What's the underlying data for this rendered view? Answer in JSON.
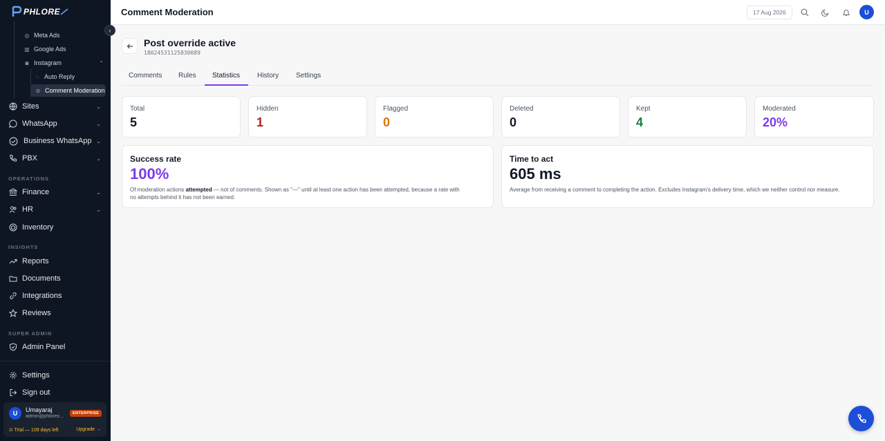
{
  "brand": {
    "name": "PHLORE"
  },
  "sidebar": {
    "sub_items": [
      {
        "label": "Meta Ads",
        "icon": "meta-icon"
      },
      {
        "label": "Google Ads",
        "icon": "building-icon"
      },
      {
        "label": "Instagram",
        "icon": "instagram-icon"
      },
      {
        "label": "Auto Reply",
        "icon": "auto-reply-icon"
      },
      {
        "label": "Comment Moderation",
        "icon": "moderation-icon"
      }
    ],
    "items": [
      {
        "label": "Sites",
        "icon": "globe-icon"
      },
      {
        "label": "WhatsApp",
        "icon": "chat-icon"
      },
      {
        "label": "Business WhatsApp",
        "icon": "check-circle-icon"
      },
      {
        "label": "PBX",
        "icon": "phone-icon"
      },
      {
        "label": "Finance",
        "icon": "bank-icon"
      },
      {
        "label": "HR",
        "icon": "people-icon"
      },
      {
        "label": "Inventory",
        "icon": "box-icon"
      },
      {
        "label": "Reports",
        "icon": "chart-icon"
      },
      {
        "label": "Documents",
        "icon": "folder-icon"
      },
      {
        "label": "Integrations",
        "icon": "link-icon"
      },
      {
        "label": "Reviews",
        "icon": "star-icon"
      },
      {
        "label": "Admin Panel",
        "icon": "shield-icon"
      },
      {
        "label": "Settings",
        "icon": "gear-icon"
      },
      {
        "label": "Sign out",
        "icon": "logout-icon"
      }
    ],
    "sections": {
      "operations": "OPERATIONS",
      "insights": "INSIGHTS",
      "super_admin": "SUPER ADMIN"
    },
    "user": {
      "initial": "U",
      "name": "Umayaraj",
      "email": "admin@phlorex...",
      "plan": "ENTERPRISE",
      "trial": "⊙ Trial — 109 days left",
      "upgrade": "Upgrade →"
    }
  },
  "topbar": {
    "title": "Comment Moderation",
    "date": "17 Aug 2026",
    "avatar": "U"
  },
  "post": {
    "title": "Post override active",
    "id": "18024531125830089"
  },
  "tabs": [
    "Comments",
    "Rules",
    "Statistics",
    "History",
    "Settings"
  ],
  "active_tab": "Statistics",
  "stats": [
    {
      "label": "Total",
      "value": "5",
      "color": "#111827"
    },
    {
      "label": "Hidden",
      "value": "1",
      "color": "#b91c1c"
    },
    {
      "label": "Flagged",
      "value": "0",
      "color": "#d97706"
    },
    {
      "label": "Deleted",
      "value": "0",
      "color": "#111827"
    },
    {
      "label": "Kept",
      "value": "4",
      "color": "#15803d"
    },
    {
      "label": "Moderated",
      "value": "20%",
      "color": "#7c3aed"
    }
  ],
  "success": {
    "title": "Success rate",
    "value": "100%",
    "desc_prefix": "Of moderation actions ",
    "desc_bold": "attempted",
    "desc_line1_rest": " — not of comments. Shown as \"—\" until at least one action has been attempted, because a rate with",
    "desc_line2": "no attempts behind it has not been earned."
  },
  "timing": {
    "title": "Time to act",
    "value": "605 ms",
    "desc": "Average from receiving a comment to completing the action. Excludes Instagram's delivery time, which we neither control nor measure."
  },
  "colors": {
    "accent": "#7c3aed",
    "primary": "#1d4ed8",
    "sidebar_bg": "#0f1623"
  }
}
